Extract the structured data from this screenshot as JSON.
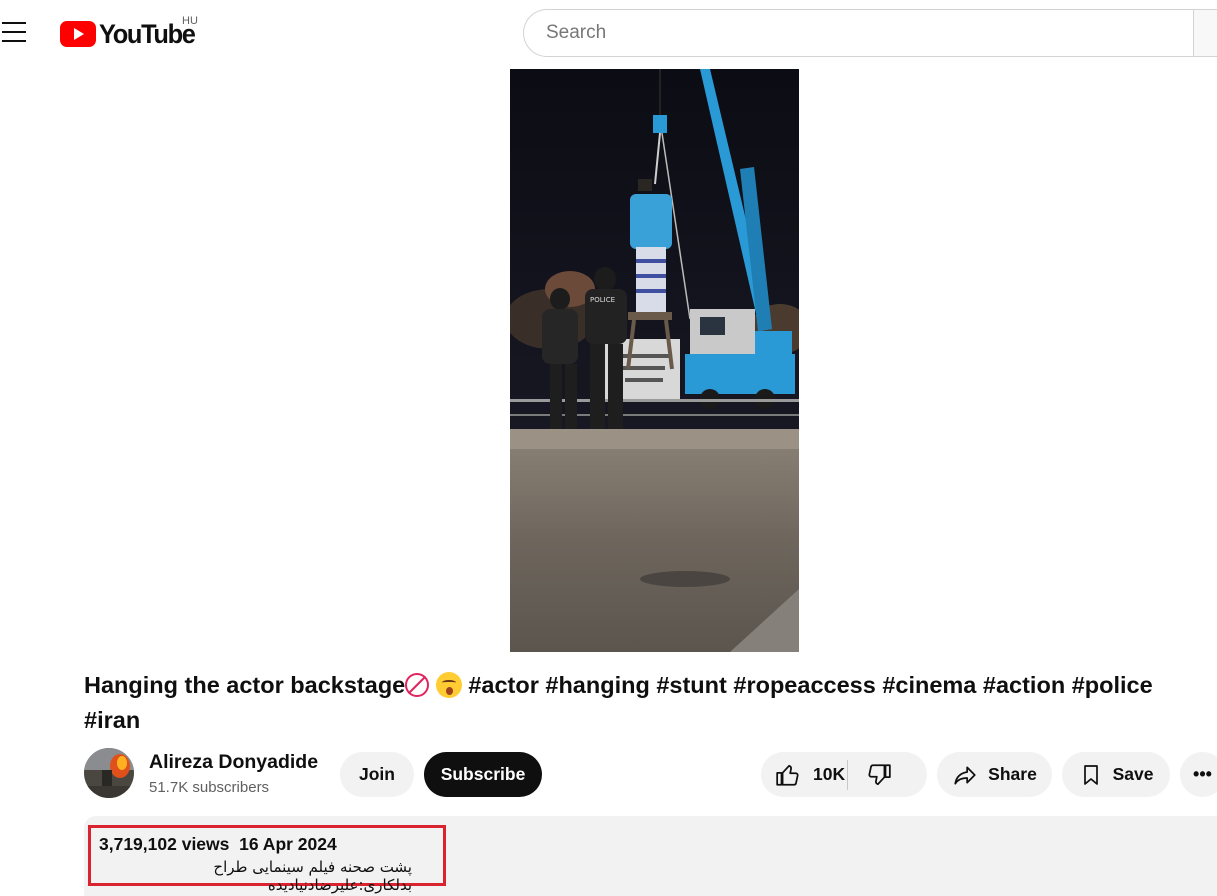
{
  "header": {
    "logo_text": "YouTube",
    "country_code": "HU",
    "search_placeholder": "Search"
  },
  "video": {
    "title": "Hanging the actor backstage",
    "title_emoji_1": "18",
    "hashtags": "#actor #hanging #stunt #ropeaccess #cinema #action #police #iran",
    "sign_text": "POLICE"
  },
  "channel": {
    "name": "Alireza Donyadide",
    "subscribers": "51.7K subscribers",
    "join_label": "Join",
    "subscribe_label": "Subscribe"
  },
  "actions": {
    "like_count": "10K",
    "share_label": "Share",
    "save_label": "Save",
    "more_label": "•••"
  },
  "description": {
    "views": "3,719,102 views",
    "date": "16 Apr 2024",
    "text": "پشت صحنه فیلم سینمایی طراح بدلکاری:علیرضادنیادیده"
  },
  "colors": {
    "brand_red": "#ff0000",
    "highlight_box": "#d9232e",
    "subscribe_bg": "#0f0f0f",
    "crane_blue": "#2a9ad6"
  }
}
